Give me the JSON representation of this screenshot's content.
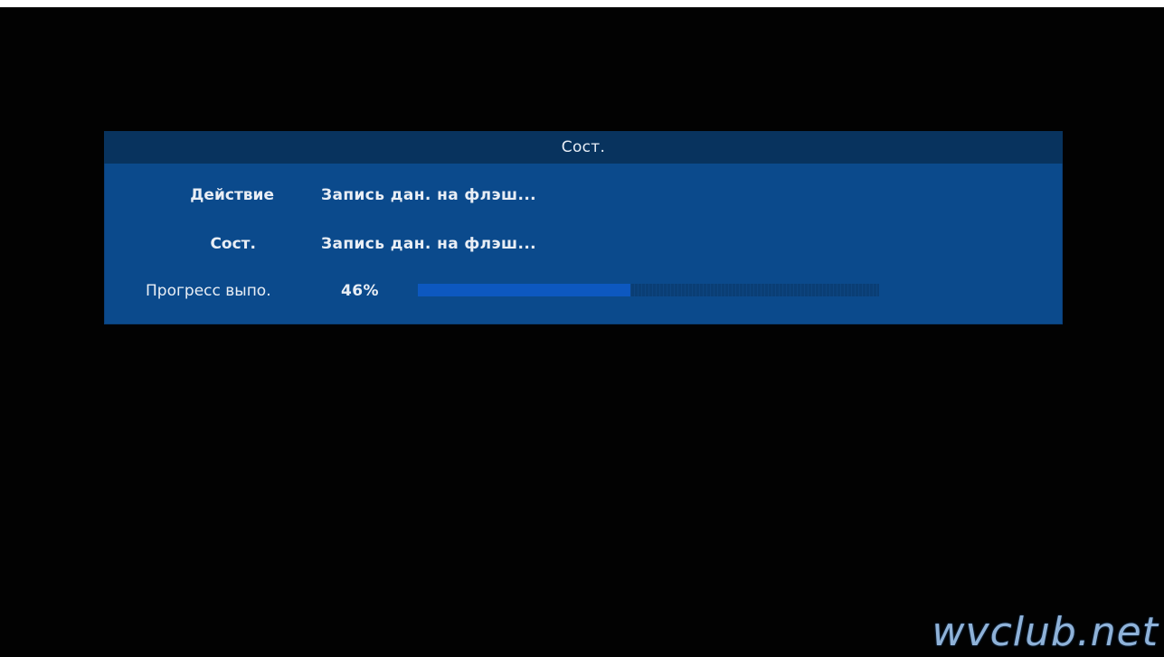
{
  "dialog": {
    "title": "Сост.",
    "rows": [
      {
        "label": "Действие",
        "value": "Запись дан. на флэш..."
      },
      {
        "label": "Сост.",
        "value": "Запись дан. на флэш..."
      }
    ],
    "progress": {
      "label": "Прогресс выпо.",
      "percent_text": "46%",
      "fraction": 0.46
    }
  },
  "watermark": "wvclub.net",
  "colors": {
    "background": "#020202",
    "dialog_bg": "#0b4a8c",
    "header_bg": "#08335e",
    "progress_fill": "#0d58c0",
    "progress_track": "#0a3e75",
    "text": "#e9eef5"
  }
}
